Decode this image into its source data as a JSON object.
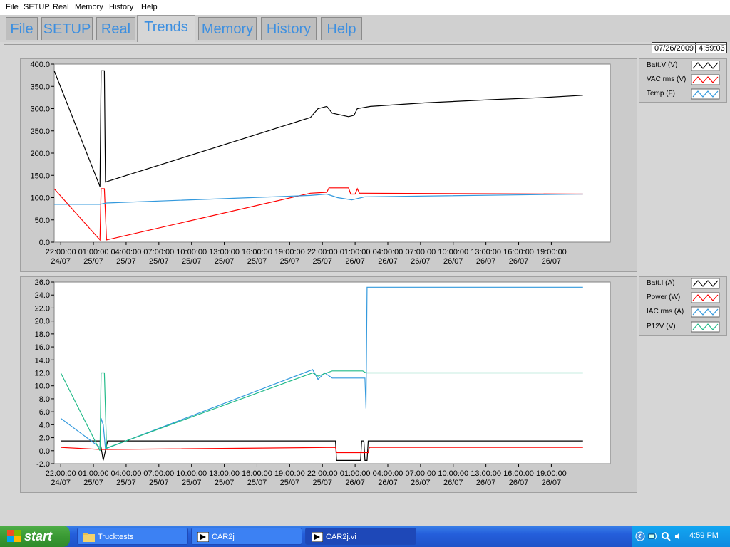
{
  "menu": [
    "File",
    "SETUP",
    "Real",
    "Memory",
    "History",
    "Help"
  ],
  "tabs": [
    {
      "label": "File",
      "active": false
    },
    {
      "label": "SETUP",
      "active": false
    },
    {
      "label": "Real",
      "active": false
    },
    {
      "label": "Trends",
      "active": true
    },
    {
      "label": "Memory",
      "active": false
    },
    {
      "label": "History",
      "active": false
    },
    {
      "label": "Help",
      "active": false
    }
  ],
  "header": {
    "date": "07/26/2009",
    "time": "4:59:03"
  },
  "charts": [
    {
      "legend": [
        {
          "name": "Batt.V (V)",
          "color": "#000000"
        },
        {
          "name": "VAC rms (V)",
          "color": "#ff0000"
        },
        {
          "name": "Temp (F)",
          "color": "#3399dd"
        }
      ],
      "ylim": [
        0,
        400
      ],
      "yticks": [
        "400.0",
        "350.0",
        "300.0",
        "250.0",
        "200.0",
        "150.0",
        "100.0",
        "50.0",
        "0.0"
      ],
      "xticks": [
        [
          "22:00:00",
          "24/07"
        ],
        [
          "01:00:00",
          "25/07"
        ],
        [
          "04:00:00",
          "25/07"
        ],
        [
          "07:00:00",
          "25/07"
        ],
        [
          "10:00:00",
          "25/07"
        ],
        [
          "13:00:00",
          "25/07"
        ],
        [
          "16:00:00",
          "25/07"
        ],
        [
          "19:00:00",
          "25/07"
        ],
        [
          "22:00:00",
          "25/07"
        ],
        [
          "01:00:00",
          "26/07"
        ],
        [
          "04:00:00",
          "26/07"
        ],
        [
          "07:00:00",
          "26/07"
        ],
        [
          "10:00:00",
          "26/07"
        ],
        [
          "13:00:00",
          "26/07"
        ],
        [
          "16:00:00",
          "26/07"
        ],
        [
          "19:00:00",
          "26/07"
        ]
      ]
    },
    {
      "legend": [
        {
          "name": "Batt.I (A)",
          "color": "#000000"
        },
        {
          "name": "Power (W)",
          "color": "#ff0000"
        },
        {
          "name": "IAC rms (A)",
          "color": "#3399dd"
        },
        {
          "name": "P12V (V)",
          "color": "#22bb88"
        }
      ],
      "ylim": [
        -2,
        26
      ],
      "yticks": [
        "26.0",
        "24.0",
        "22.0",
        "20.0",
        "18.0",
        "16.0",
        "14.0",
        "12.0",
        "10.0",
        "8.0",
        "6.0",
        "4.0",
        "2.0",
        "0.0",
        "-2.0"
      ],
      "xticks": [
        [
          "22:00:00",
          "24/07"
        ],
        [
          "01:00:00",
          "25/07"
        ],
        [
          "04:00:00",
          "25/07"
        ],
        [
          "07:00:00",
          "25/07"
        ],
        [
          "10:00:00",
          "25/07"
        ],
        [
          "13:00:00",
          "25/07"
        ],
        [
          "16:00:00",
          "25/07"
        ],
        [
          "19:00:00",
          "25/07"
        ],
        [
          "22:00:00",
          "25/07"
        ],
        [
          "01:00:00",
          "26/07"
        ],
        [
          "04:00:00",
          "26/07"
        ],
        [
          "07:00:00",
          "26/07"
        ],
        [
          "10:00:00",
          "26/07"
        ],
        [
          "13:00:00",
          "26/07"
        ],
        [
          "16:00:00",
          "26/07"
        ],
        [
          "19:00:00",
          "26/07"
        ]
      ]
    }
  ],
  "chart_data": [
    {
      "type": "line",
      "x_unit": "hours from 22:00:00 24/07",
      "ylim": [
        0,
        400
      ],
      "series": [
        {
          "name": "Batt.V (V)",
          "color": "#000000",
          "points": [
            [
              0,
              385
            ],
            [
              4.2,
              125
            ],
            [
              4.3,
              385
            ],
            [
              4.6,
              385
            ],
            [
              4.7,
              135
            ],
            [
              23.5,
              280
            ],
            [
              24.2,
              300
            ],
            [
              25.0,
              305
            ],
            [
              25.5,
              290
            ],
            [
              27.0,
              282
            ],
            [
              27.5,
              285
            ],
            [
              27.8,
              300
            ],
            [
              29,
              305
            ],
            [
              34,
              313
            ],
            [
              40,
              320
            ],
            [
              45,
              325
            ],
            [
              48.5,
              330
            ]
          ]
        },
        {
          "name": "VAC rms (V)",
          "color": "#ff0000",
          "points": [
            [
              0,
              120
            ],
            [
              4.2,
              5
            ],
            [
              4.3,
              120
            ],
            [
              4.6,
              120
            ],
            [
              4.8,
              5
            ],
            [
              23.5,
              110
            ],
            [
              25.0,
              112
            ],
            [
              25.2,
              122
            ],
            [
              27.0,
              122
            ],
            [
              27.2,
              108
            ],
            [
              27.6,
              108
            ],
            [
              27.8,
              120
            ],
            [
              28.0,
              110
            ],
            [
              48.5,
              108
            ]
          ]
        },
        {
          "name": "Temp (F)",
          "color": "#3399dd",
          "points": [
            [
              0,
              85
            ],
            [
              4.2,
              85
            ],
            [
              4.8,
              88
            ],
            [
              23.5,
              105
            ],
            [
              25.0,
              108
            ],
            [
              26.0,
              100
            ],
            [
              27.3,
              95
            ],
            [
              28.5,
              102
            ],
            [
              48.5,
              108
            ]
          ]
        }
      ]
    },
    {
      "type": "line",
      "x_unit": "hours from 22:00:00 24/07",
      "ylim": [
        -2,
        26
      ],
      "series": [
        {
          "name": "Batt.I (A)",
          "color": "#000000",
          "points": [
            [
              0.6,
              1.5
            ],
            [
              4.2,
              1.5
            ],
            [
              4.5,
              -1.5
            ],
            [
              4.9,
              1.5
            ],
            [
              25.8,
              1.5
            ],
            [
              25.9,
              -1.5
            ],
            [
              28.1,
              -1.5
            ],
            [
              28.2,
              1.5
            ],
            [
              28.4,
              1.5
            ],
            [
              28.5,
              -1.5
            ],
            [
              28.7,
              -1.5
            ],
            [
              28.8,
              1.5
            ],
            [
              48.5,
              1.5
            ]
          ]
        },
        {
          "name": "Power (W)",
          "color": "#ff0000",
          "points": [
            [
              0.6,
              0.5
            ],
            [
              4.2,
              0.2
            ],
            [
              4.9,
              0.2
            ],
            [
              25.8,
              0.5
            ],
            [
              25.9,
              -0.3
            ],
            [
              28.8,
              -0.3
            ],
            [
              28.9,
              0.5
            ],
            [
              48.5,
              0.5
            ]
          ]
        },
        {
          "name": "IAC rms (A)",
          "color": "#3399dd",
          "points": [
            [
              0.6,
              5
            ],
            [
              4.2,
              0.5
            ],
            [
              4.3,
              5
            ],
            [
              4.5,
              4
            ],
            [
              4.7,
              0.3
            ],
            [
              23.7,
              12.5
            ],
            [
              24.2,
              11
            ],
            [
              24.8,
              12
            ],
            [
              25.5,
              11.2
            ],
            [
              28.5,
              11.2
            ],
            [
              28.6,
              6.5
            ],
            [
              28.7,
              25.2
            ],
            [
              48.5,
              25.2
            ]
          ]
        },
        {
          "name": "P12V (V)",
          "color": "#22bb88",
          "points": [
            [
              0.6,
              12
            ],
            [
              4.2,
              0
            ],
            [
              4.3,
              12
            ],
            [
              4.6,
              12
            ],
            [
              4.8,
              0.4
            ],
            [
              23.7,
              12
            ],
            [
              24.2,
              11.5
            ],
            [
              25.0,
              12
            ],
            [
              25.5,
              12.3
            ],
            [
              28.3,
              12.3
            ],
            [
              28.6,
              12
            ],
            [
              48.5,
              12
            ]
          ]
        }
      ]
    }
  ],
  "taskbar": {
    "start": "start",
    "tasks": [
      {
        "label": "Trucktests",
        "active": false
      },
      {
        "label": "CAR2j",
        "active": false
      },
      {
        "label": "CAR2j.vi",
        "active": true
      }
    ],
    "clock": "4:59 PM"
  }
}
